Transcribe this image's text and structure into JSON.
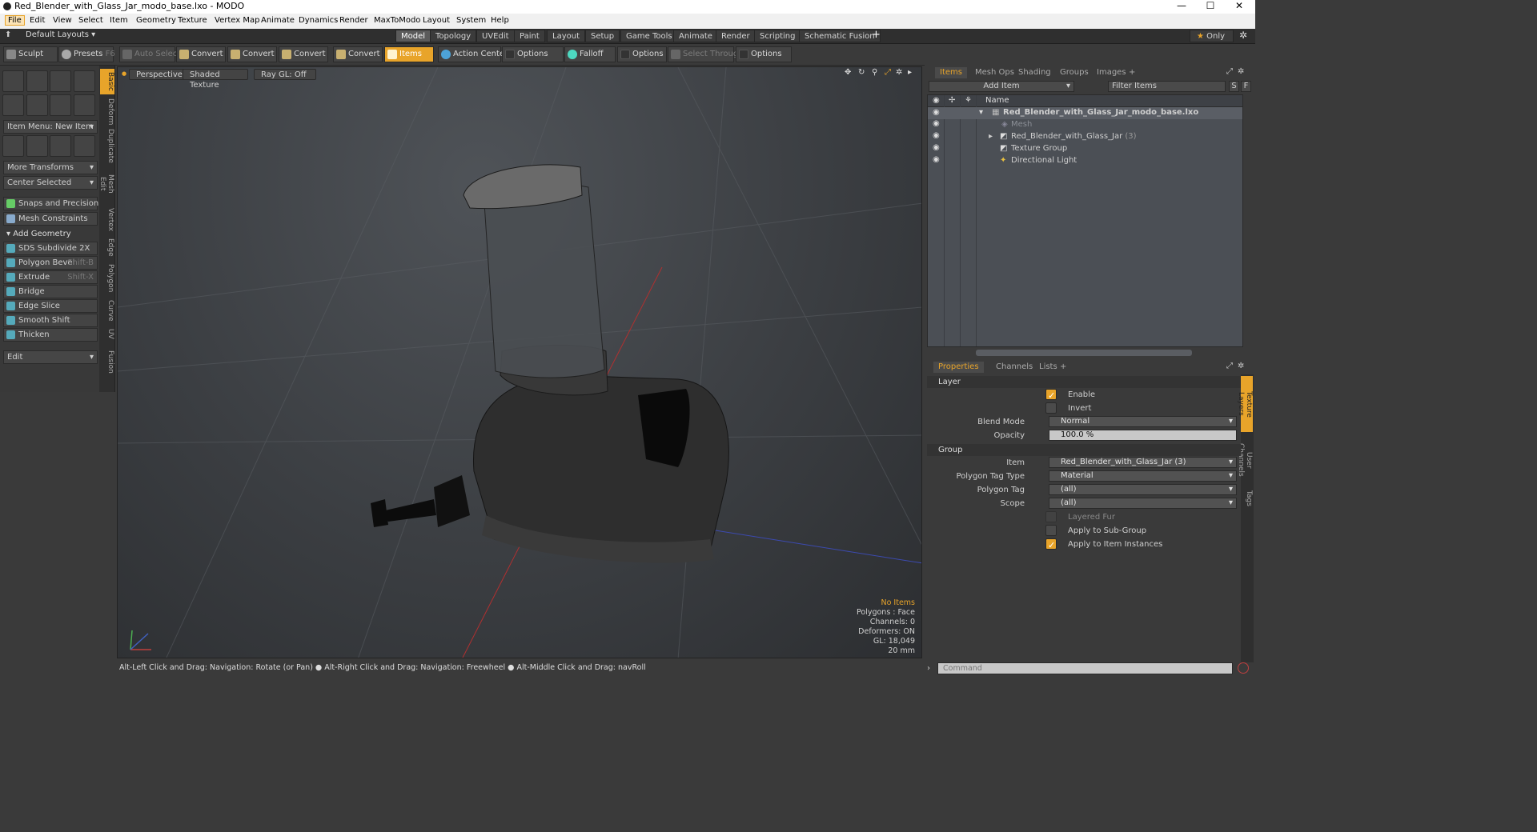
{
  "window": {
    "title": "Red_Blender_with_Glass_Jar_modo_base.lxo - MODO",
    "minimize": "—",
    "maximize": "☐",
    "close": "✕"
  },
  "menu": [
    "File",
    "Edit",
    "View",
    "Select",
    "Item",
    "Geometry",
    "Texture",
    "Vertex Map",
    "Animate",
    "Dynamics",
    "Render",
    "MaxToModo",
    "Layout",
    "System",
    "Help"
  ],
  "layoutbar": {
    "layouts": "Default Layouts",
    "tabs": [
      "Model",
      "Topology",
      "UVEdit",
      "Paint",
      "Layout",
      "Setup",
      "Game Tools",
      "Animate",
      "Render",
      "Scripting",
      "Schematic Fusion"
    ],
    "active": "Model",
    "add": "+",
    "only": "Only"
  },
  "toolbar": {
    "sculpt": "Sculpt",
    "presets": "Presets",
    "presets_key": "F6",
    "auto_select": "Auto Select",
    "convert": "Convert",
    "items": "Items",
    "action_center": "Action Center",
    "options": "Options",
    "falloff": "Falloff",
    "select_through": "Select Through"
  },
  "left": {
    "item_menu": "Item Menu: New Item",
    "more_transforms": "More Transforms",
    "center_selected": "Center Selected",
    "snaps": "Snaps and Precision",
    "mesh_constraints": "Mesh Constraints",
    "add_geometry": "Add Geometry",
    "tools": [
      {
        "label": "SDS Subdivide 2X",
        "key": ""
      },
      {
        "label": "Polygon Bevel",
        "key": "Shift-B"
      },
      {
        "label": "Extrude",
        "key": "Shift-X"
      },
      {
        "label": "Bridge",
        "key": ""
      },
      {
        "label": "Edge Slice",
        "key": ""
      },
      {
        "label": "Smooth Shift",
        "key": ""
      },
      {
        "label": "Thicken",
        "key": ""
      }
    ],
    "edit": "Edit",
    "vtabs": [
      "Basic",
      "Deform",
      "Duplicate",
      "Mesh Edit",
      "Vertex",
      "Edge",
      "Polygon",
      "Curve",
      "UV",
      "Fusion"
    ]
  },
  "viewport": {
    "perspective": "Perspective",
    "shading": "Shaded Texture",
    "raygl": "Ray GL: Off",
    "stats": {
      "items": "No Items",
      "polygons": "Polygons : Face",
      "channels": "Channels: 0",
      "deformers": "Deformers: ON",
      "gl": "GL: 18,049",
      "unit": "20 mm"
    }
  },
  "statusbar": "Alt-Left Click and Drag: Navigation: Rotate (or Pan) ● Alt-Right Click and Drag: Navigation: Freewheel ● Alt-Middle Click and Drag: navRoll",
  "items_panel": {
    "tabs": [
      "Items",
      "Mesh Ops",
      "Shading",
      "Groups",
      "Images"
    ],
    "add_item": "Add Item",
    "filter": "Filter Items",
    "s": "S",
    "f": "F",
    "name_col": "Name",
    "rows": [
      {
        "label": "Red_Blender_with_Glass_Jar_modo_base.lxo",
        "count": ""
      },
      {
        "label": "Mesh",
        "count": ""
      },
      {
        "label": "Red_Blender_with_Glass_Jar",
        "count": "(3)"
      },
      {
        "label": "Texture Group",
        "count": ""
      },
      {
        "label": "Directional Light",
        "count": ""
      }
    ]
  },
  "properties_panel": {
    "tabs": [
      "Properties",
      "Channels",
      "Lists"
    ],
    "side_tabs": [
      "Texture Layers",
      "User Channels",
      "Tags"
    ],
    "layer_section": "Layer",
    "enable": "Enable",
    "invert": "Invert",
    "blend_mode_label": "Blend Mode",
    "blend_mode": "Normal",
    "opacity_label": "Opacity",
    "opacity": "100.0 %",
    "group_section": "Group",
    "item_label": "Item",
    "item": "Red_Blender_with_Glass_Jar (3)",
    "ptag_type_label": "Polygon Tag Type",
    "ptag_type": "Material",
    "ptag_label": "Polygon Tag",
    "ptag": "(all)",
    "scope_label": "Scope",
    "scope": "(all)",
    "layered_fur": "Layered Fur",
    "apply_sub": "Apply to Sub-Group",
    "apply_inst": "Apply to Item Instances"
  },
  "command": {
    "placeholder": "Command"
  }
}
